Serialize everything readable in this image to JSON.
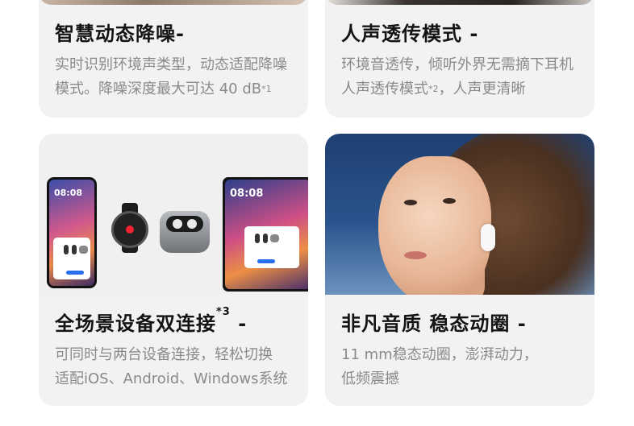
{
  "cards": [
    {
      "title": "智慧动态降噪-",
      "desc_line1": "实时识别环境声类型，动态适配降噪",
      "desc_line2_prefix": "模式。降噪深度最大可达 40 dB",
      "desc_line2_sup": "*1"
    },
    {
      "title": "人声透传模式 -",
      "desc_line1": "环境音透传，倾听外界无需摘下耳机",
      "desc_line2_prefix": "人声透传模式",
      "desc_line2_sup": "*2",
      "desc_line2_suffix": "，人声更清晰"
    },
    {
      "title_prefix": "全场景设备双连接",
      "title_sup": "*3",
      "title_suffix": " -",
      "desc_line1": "可同时与两台设备连接，轻松切换",
      "desc_line2": "适配iOS、Android、Windows系统",
      "device_time": "08:08"
    },
    {
      "title": "非凡音质 稳态动圈 -",
      "desc_line1": "11 mm稳态动圈，澎湃动力，",
      "desc_line2": "低频震撼"
    }
  ],
  "colors": {
    "card_bg": "#f2f2f2",
    "title": "#141414",
    "desc": "#8a8a8a"
  }
}
